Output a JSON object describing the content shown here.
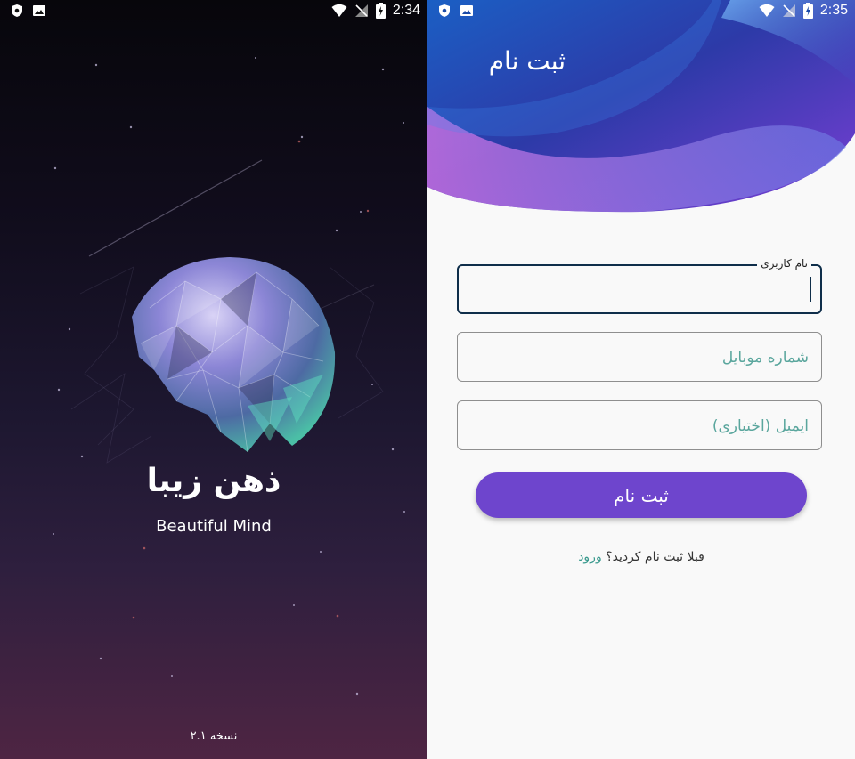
{
  "left_screen": {
    "status_bar": {
      "time": "2:34",
      "icons": [
        "shield-icon",
        "image-icon",
        "wifi-icon",
        "no-signal-icon",
        "battery-charging-icon"
      ]
    },
    "app_title": "ذهن زیبا",
    "app_subtitle": "Beautiful Mind",
    "version": "نسخه ۲.۱"
  },
  "right_screen": {
    "status_bar": {
      "time": "2:35",
      "icons": [
        "shield-icon",
        "image-icon",
        "wifi-icon",
        "no-signal-icon",
        "battery-charging-icon"
      ]
    },
    "header_title": "ثبت نام",
    "fields": {
      "username_label": "نام کاربری",
      "mobile_placeholder": "شماره موبایل",
      "email_placeholder": "ایمیل (اختیاری)"
    },
    "submit_label": "ثبت نام",
    "login_prompt": "قبلا ثبت نام کردید؟",
    "login_link": "ورود"
  },
  "colors": {
    "accent_button": "#6e45cd",
    "hint_text": "#5aa69d",
    "focused_border": "#0f2e4a"
  }
}
